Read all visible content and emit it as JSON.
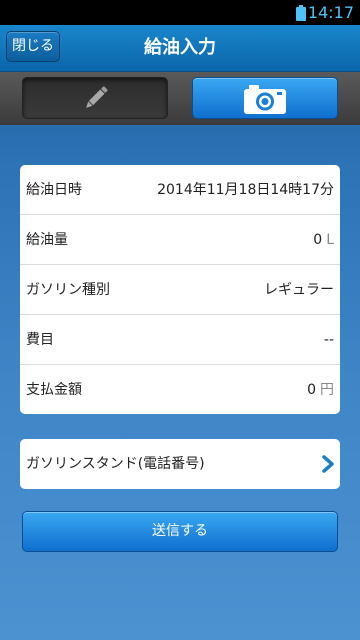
{
  "status_bar": {
    "time": "14:17",
    "battery_icon": "battery-full-icon",
    "accent_color": "#4fc3f7"
  },
  "action_bar": {
    "close_label": "閉じる",
    "title": "給油入力"
  },
  "mode_toggle": {
    "edit_icon": "pencil-icon",
    "camera_icon": "camera-icon",
    "selected": "camera"
  },
  "form": {
    "rows": [
      {
        "label": "給油日時",
        "value": "2014年11月18日14時17分",
        "unit": ""
      },
      {
        "label": "給油量",
        "value": "0",
        "unit": "L"
      },
      {
        "label": "ガソリン種別",
        "value": "レギュラー",
        "unit": ""
      },
      {
        "label": "費目",
        "value": "--",
        "unit": ""
      },
      {
        "label": "支払金額",
        "value": "0",
        "unit": "円"
      }
    ]
  },
  "station": {
    "label": "ガソリンスタンド(電話番号)",
    "chevron_icon": "chevron-right-icon"
  },
  "send_button": {
    "label": "送信する"
  },
  "colors": {
    "primary_blue": "#1a86cc",
    "button_blue": "#2a8fe0",
    "background": "#3f86c7"
  }
}
